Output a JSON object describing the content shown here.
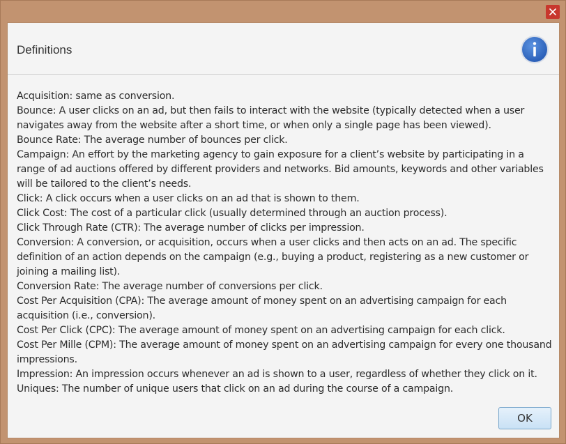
{
  "window": {
    "close_icon": "close-icon",
    "close_color": "#c8372d"
  },
  "dialog": {
    "title": "Definitions",
    "info_icon": "info-icon",
    "info_color": "#2f6bc7"
  },
  "definitions": [
    "Acquisition: same as conversion.",
    "Bounce: A user clicks on an ad, but then fails to interact with the website (typically detected when a user navigates away from the website after a short time, or when only a single page has been viewed).",
    "Bounce Rate: The average number of bounces per click.",
    "Campaign: An effort by the marketing agency to gain exposure for a client’s website by participating in a range of ad auctions offered by different providers and networks. Bid amounts, keywords and other variables will be tailored to the client’s needs.",
    "Click: A click occurs when a user clicks on an ad that is shown to them.",
    "Click Cost: The cost of a particular click (usually determined through an auction process).",
    "Click Through Rate (CTR): The average number of clicks per impression.",
    "Conversion: A conversion, or acquisition, occurs when a user clicks and then acts on an ad. The specific definition of an action depends on the campaign (e.g., buying a product, registering as a new customer or joining a mailing list).",
    "Conversion Rate: The average number of conversions per click.",
    "Cost Per Acquisition (CPA): The average amount of money spent on an advertising campaign for each acquisition (i.e., conversion).",
    "Cost Per Click (CPC): The average amount of money spent on an advertising campaign for each click.",
    "Cost Per Mille (CPM): The average amount of money spent on an advertising campaign for every one thousand impressions.",
    "Impression: An impression occurs whenever an ad is shown to a user, regardless of whether they click on it.",
    "Uniques: The number of unique users that click on an ad during the course of a campaign."
  ],
  "footer": {
    "ok_label": "OK"
  }
}
